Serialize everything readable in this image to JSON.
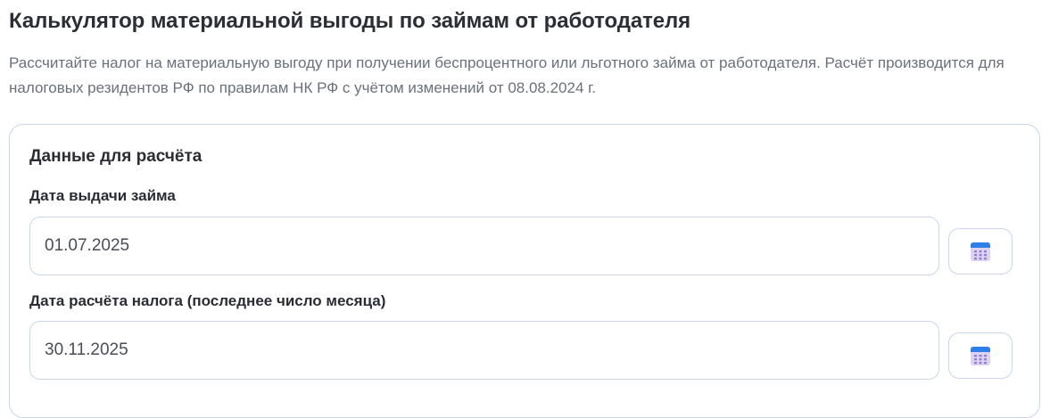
{
  "page": {
    "title": "Калькулятор материальной выгоды по займам от работодателя",
    "description": "Рассчитайте налог на материальную выгоду при получении беспроцентного или льготного займа от работодателя. Расчёт производится для налоговых резидентов РФ по правилам НК РФ с учётом изменений от 08.08.2024 г."
  },
  "form": {
    "section_title": "Данные для расчёта",
    "loan_date": {
      "label": "Дата выдачи займа",
      "value": "01.07.2025",
      "picker_icon": "calendar-icon"
    },
    "calc_date": {
      "label": "Дата расчёта налога (последнее число месяца)",
      "value": "30.11.2025",
      "picker_icon": "calendar-icon"
    }
  },
  "colors": {
    "border": "#c9d6ea",
    "calendar_header": "#2f7fe8",
    "calendar_body": "#ddd3f1",
    "calendar_dots": "#8e7fd2",
    "muted_text": "#6b7079"
  }
}
